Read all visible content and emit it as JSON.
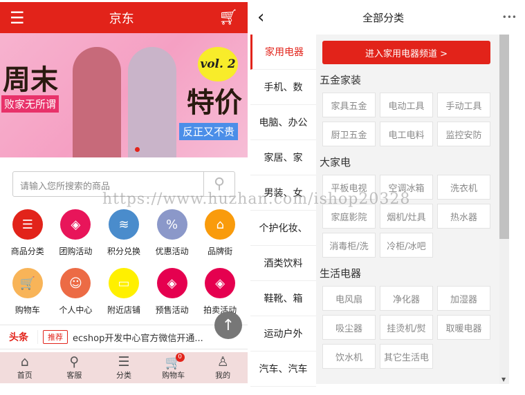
{
  "left": {
    "header": {
      "title": "京东"
    },
    "banner": {
      "title1": "周末",
      "sub1": "败家无所谓",
      "title2": "特价",
      "sub2": "反正又不贵",
      "badge": "vol. 2"
    },
    "search": {
      "placeholder": "请输入您所搜索的商品"
    },
    "icons": [
      {
        "label": "商品分类",
        "color": "#e2231a",
        "glyph": "☰"
      },
      {
        "label": "团购活动",
        "color": "#e8155a",
        "glyph": "◈"
      },
      {
        "label": "积分兑换",
        "color": "#4a8ccc",
        "glyph": "≋"
      },
      {
        "label": "优惠活动",
        "color": "#8b98c9",
        "glyph": "%"
      },
      {
        "label": "品牌街",
        "color": "#f99b0c",
        "glyph": "⌂"
      },
      {
        "label": "购物车",
        "color": "#f8b458",
        "glyph": "🛒"
      },
      {
        "label": "个人中心",
        "color": "#ec6b45",
        "glyph": "☺"
      },
      {
        "label": "附近店铺",
        "color": "#fff000",
        "glyph": "▭"
      },
      {
        "label": "预售活动",
        "color": "#e5004f",
        "glyph": "◈"
      },
      {
        "label": "拍卖活动",
        "color": "#e5004f",
        "glyph": "◈"
      }
    ],
    "ticker": {
      "head": "头条",
      "tag": "推荐",
      "text": "ecshop开发中心官方微信开通..."
    },
    "nav": [
      {
        "label": "首页",
        "glyph": "⌂"
      },
      {
        "label": "客服",
        "glyph": "⚲"
      },
      {
        "label": "分类",
        "glyph": "☰"
      },
      {
        "label": "购物车",
        "glyph": "🛒",
        "badge": "0"
      },
      {
        "label": "我的",
        "glyph": "♙"
      }
    ]
  },
  "right": {
    "header": {
      "back": "‹",
      "title": "全部分类",
      "more": "•••"
    },
    "sidebar": [
      "家用电器",
      "手机、数",
      "电脑、办公",
      "家居、家",
      "男装、女",
      "个护化妆、",
      "酒类饮料",
      "鞋靴、箱",
      "运动户外",
      "汽车、汽车"
    ],
    "enter_button": "进入家用电器频道 >",
    "sections": [
      {
        "title": "五金家装",
        "items": [
          "家具五金",
          "电动工具",
          "手动工具",
          "厨卫五金",
          "电工电料",
          "监控安防"
        ]
      },
      {
        "title": "大家电",
        "items": [
          "平板电视",
          "空调冰箱",
          "洗衣机",
          "家庭影院",
          "烟机/灶具",
          "热水器",
          "消毒柜/洗",
          "冷柜/冰吧"
        ]
      },
      {
        "title": "生活电器",
        "items": [
          "电风扇",
          "净化器",
          "加湿器",
          "吸尘器",
          "挂烫机/熨",
          "取暖电器",
          "饮水机",
          "其它生活电"
        ]
      }
    ]
  },
  "watermark": "https://www.huzhan.com/ishop20328",
  "accent": "#e2231a"
}
